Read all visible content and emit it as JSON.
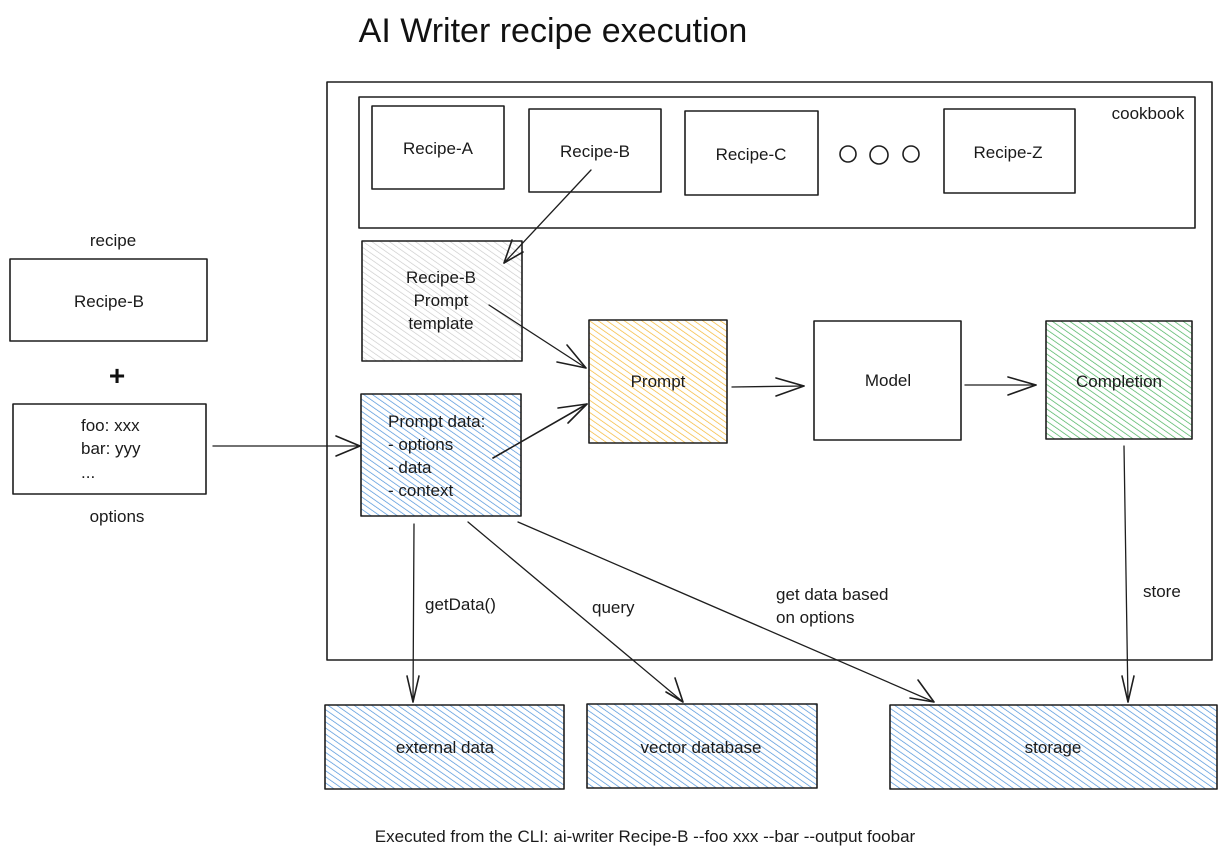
{
  "title": "AI Writer recipe execution",
  "left": {
    "recipe_label": "recipe",
    "recipe_box": "Recipe-B",
    "plus": "+",
    "options_lines": [
      "foo: xxx",
      "bar: yyy",
      "..."
    ],
    "options_label": "options"
  },
  "cookbook": {
    "label": "cookbook",
    "recipes": [
      "Recipe-A",
      "Recipe-B",
      "Recipe-C",
      "Recipe-Z"
    ],
    "ellipsis_dots": 3
  },
  "nodes": {
    "template": [
      "Recipe-B",
      "Prompt",
      "template"
    ],
    "prompt_data": [
      "Prompt data:",
      "- options",
      "- data",
      "- context"
    ],
    "prompt": "Prompt",
    "model": "Model",
    "completion": "Completion"
  },
  "stores": {
    "external": "external data",
    "vector": "vector database",
    "storage": "storage"
  },
  "edge_labels": {
    "get_data": "getData()",
    "query": "query",
    "get_based": [
      "get data based",
      "on options"
    ],
    "store": "store"
  },
  "footer": "Executed from the CLI: ai-writer Recipe-B --foo xxx --bar --output foobar",
  "colors": {
    "template_fill": "#c9c9c9",
    "prompt_data_fill": "#4a90d9",
    "prompt_fill": "#f5b731",
    "completion_fill": "#45b05a",
    "store_fill": "#4a90d9",
    "stroke": "#1e1e1e"
  }
}
